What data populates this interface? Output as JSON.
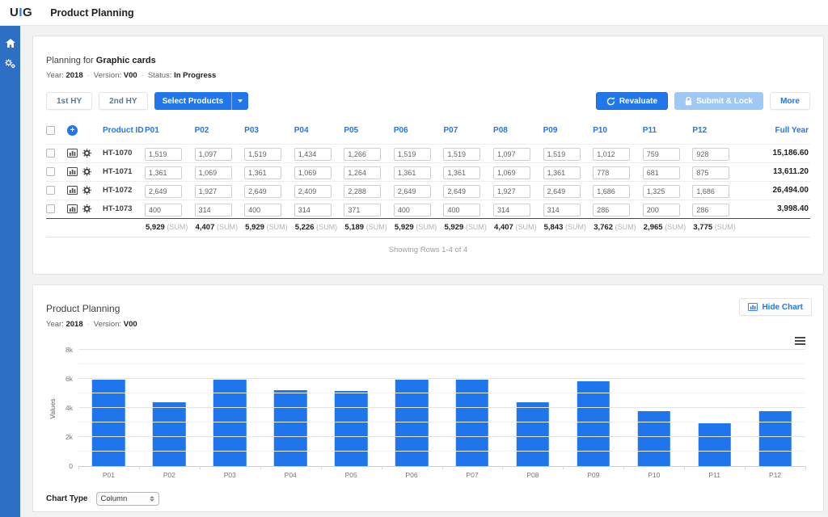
{
  "app": {
    "logo_u": "U",
    "logo_i": "I",
    "logo_g": "G",
    "title": "Product Planning"
  },
  "sidebar": {
    "items": [
      {
        "icon": "home-icon"
      },
      {
        "icon": "cogs-icon"
      }
    ]
  },
  "planning": {
    "heading_prefix": "Planning for",
    "heading_subject": "Graphic cards",
    "meta_separator": "·",
    "meta": [
      {
        "label": "Year:",
        "value": "2018"
      },
      {
        "label": "Version:",
        "value": "V00"
      },
      {
        "label": "Status:",
        "value": "In Progress"
      }
    ],
    "buttons": {
      "first_hy": "1st HY",
      "second_hy": "2nd HY",
      "select_products": "Select Products",
      "revaluate": "Revaluate",
      "submit_lock": "Submit & Lock",
      "more": "More"
    },
    "table": {
      "product_id_header": "Product ID",
      "full_year_header": "Full Year",
      "period_headers": [
        "P01",
        "P02",
        "P03",
        "P04",
        "P05",
        "P06",
        "P07",
        "P08",
        "P09",
        "P10",
        "P11",
        "P12"
      ],
      "rows": [
        {
          "id": "HT-1070",
          "values": [
            "1,519",
            "1,097",
            "1,519",
            "1,434",
            "1,266",
            "1,519",
            "1,519",
            "1,097",
            "1,519",
            "1,012",
            "759",
            "928"
          ],
          "full_year": "15,186.60"
        },
        {
          "id": "HT-1071",
          "values": [
            "1,361",
            "1,069",
            "1,361",
            "1,069",
            "1,264",
            "1,361",
            "1,361",
            "1,069",
            "1,361",
            "778",
            "681",
            "875"
          ],
          "full_year": "13,611.20"
        },
        {
          "id": "HT-1072",
          "values": [
            "2,649",
            "1,927",
            "2,649",
            "2,409",
            "2,288",
            "2,649",
            "2,649",
            "1,927",
            "2,649",
            "1,686",
            "1,325",
            "1,686"
          ],
          "full_year": "26,494.00"
        },
        {
          "id": "HT-1073",
          "values": [
            "400",
            "314",
            "400",
            "314",
            "371",
            "400",
            "400",
            "314",
            "314",
            "286",
            "200",
            "286"
          ],
          "full_year": "3,998.40"
        }
      ],
      "sum_row": {
        "values": [
          "5,929",
          "4,407",
          "5,929",
          "5,226",
          "5,189",
          "5,929",
          "5,929",
          "4,407",
          "5,843",
          "3,762",
          "2,965",
          "3,775"
        ],
        "suffix": "(SUM)"
      },
      "footer": "Showing Rows 1-4 of 4"
    }
  },
  "chart_section": {
    "title": "Product Planning",
    "meta": [
      {
        "label": "Year:",
        "value": "2018"
      },
      {
        "label": "Version:",
        "value": "V00"
      }
    ],
    "hide_chart_label": "Hide Chart",
    "chart_type_label": "Chart Type",
    "chart_type_value": "Column"
  },
  "chart_data": {
    "type": "bar",
    "categories": [
      "P01",
      "P02",
      "P03",
      "P04",
      "P05",
      "P06",
      "P07",
      "P08",
      "P09",
      "P10",
      "P11",
      "P12"
    ],
    "values": [
      5929,
      4407,
      5929,
      5226,
      5189,
      5929,
      5929,
      4407,
      5843,
      3762,
      2965,
      3775
    ],
    "title": "",
    "xlabel": "",
    "ylabel": "Values",
    "ylim": [
      0,
      8000
    ],
    "ytick_step": 1000,
    "ytick_labels": [
      "0",
      "2k",
      "4k",
      "6k",
      "8k"
    ],
    "bar_color": "#1f76ec",
    "grid": true,
    "legend": false
  },
  "colors": {
    "accent": "#2176ec",
    "sidebar": "#2d6fc4",
    "disabled_button": "#a0c8f5",
    "bar": "#1f76ec"
  }
}
